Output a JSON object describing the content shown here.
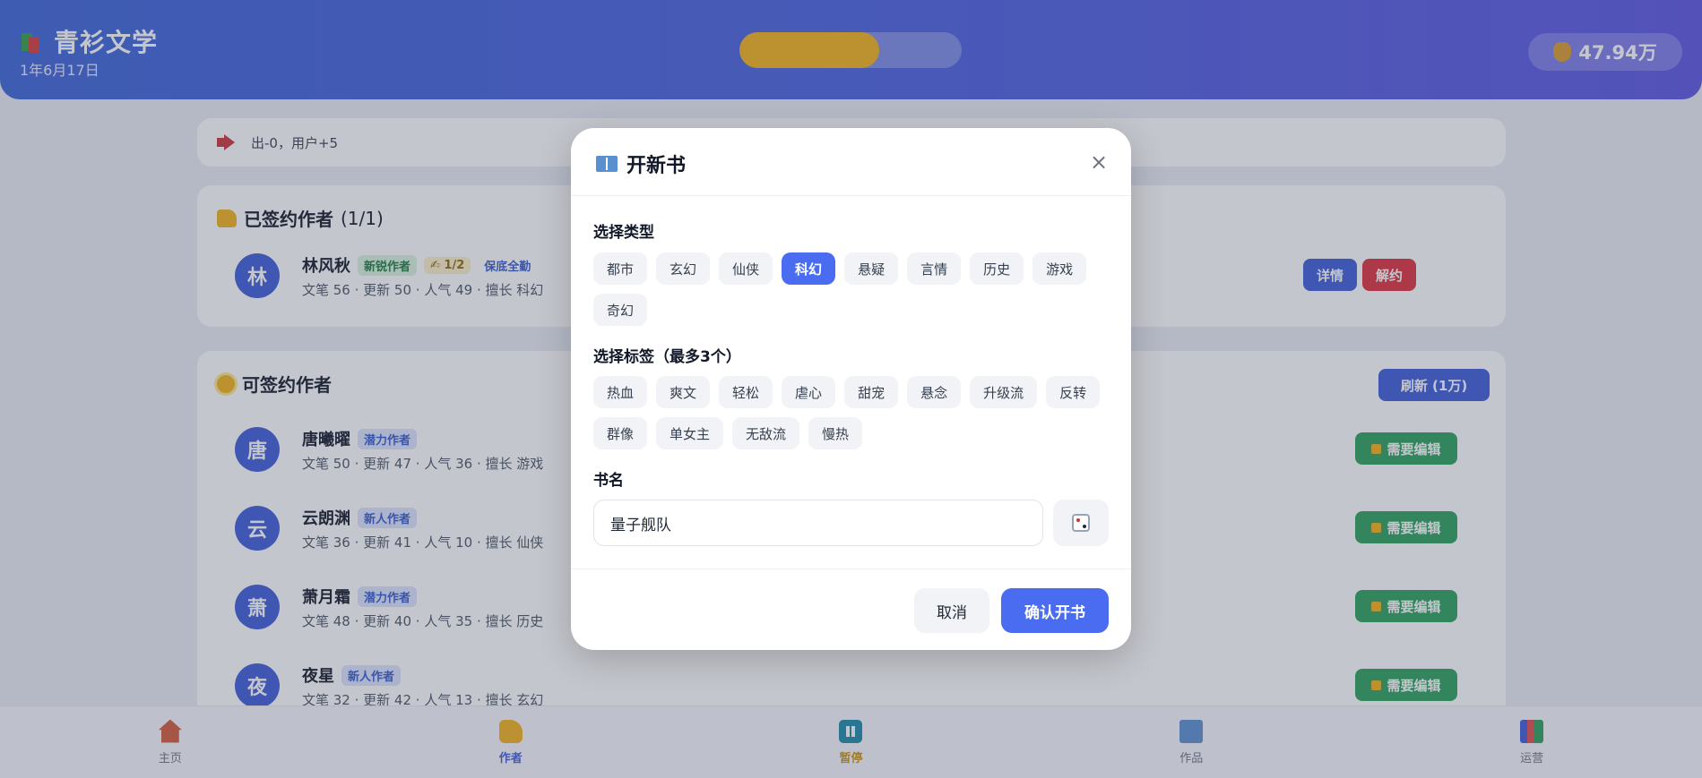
{
  "header": {
    "title": "青衫文学",
    "date": "1年6月17日",
    "progress": 0.63,
    "money": "47.94万",
    "colors": {
      "header": "#3a63d8",
      "progress": "#f3b31a"
    }
  },
  "notice": {
    "text": "出-0，用户+5",
    "icon": "megaphone-icon"
  },
  "signed": {
    "title": "已签约作者",
    "count": "(1/1)",
    "authors": [
      {
        "initial": "林",
        "name": "林风秋",
        "badges": [
          "新锐作者",
          "✍ 1/2",
          "保底全勤"
        ],
        "meta": "文笔 56 · 更新 50 · 人气 49 · 擅长 科幻",
        "detail": "详情",
        "terminate": "解约"
      }
    ]
  },
  "available": {
    "title": "可签约作者",
    "refresh": "刷新 (1万)",
    "authors": [
      {
        "initial": "唐",
        "name": "唐曦曜",
        "badge": "潜力作者",
        "meta": "文笔 50 · 更新 47 · 人气 36 · 擅长 游戏",
        "action": "需要编辑"
      },
      {
        "initial": "云",
        "name": "云朗渊",
        "badge": "新人作者",
        "meta": "文笔 36 · 更新 41 · 人气 10 · 擅长 仙侠",
        "action": "需要编辑"
      },
      {
        "initial": "萧",
        "name": "萧月霜",
        "badge": "潜力作者",
        "meta": "文笔 48 · 更新 40 · 人气 35 · 擅长 历史",
        "action": "需要编辑"
      },
      {
        "initial": "夜",
        "name": "夜星",
        "badge": "新人作者",
        "meta": "文笔 32 · 更新 42 · 人气 13 · 擅长 玄幻",
        "action": "需要编辑"
      }
    ]
  },
  "nav": [
    {
      "label": "主页",
      "icon": "home-icon"
    },
    {
      "label": "作者",
      "icon": "writing-hand-icon"
    },
    {
      "label": "暂停",
      "icon": "pause-icon"
    },
    {
      "label": "作品",
      "icon": "book-icon"
    },
    {
      "label": "运营",
      "icon": "bar-chart-icon"
    }
  ],
  "modal": {
    "title": "开新书",
    "close": "×",
    "type_label": "选择类型",
    "types": [
      "都市",
      "玄幻",
      "仙侠",
      "科幻",
      "悬疑",
      "言情",
      "历史",
      "游戏",
      "奇幻"
    ],
    "selected_type": "科幻",
    "tag_label": "选择标签（最多3个）",
    "tags": [
      "热血",
      "爽文",
      "轻松",
      "虐心",
      "甜宠",
      "悬念",
      "升级流",
      "反转",
      "群像",
      "单女主",
      "无敌流",
      "慢热"
    ],
    "name_label": "书名",
    "name_value": "量子舰队",
    "cancel": "取消",
    "confirm": "确认开书",
    "accent": "#4a6cf1"
  }
}
